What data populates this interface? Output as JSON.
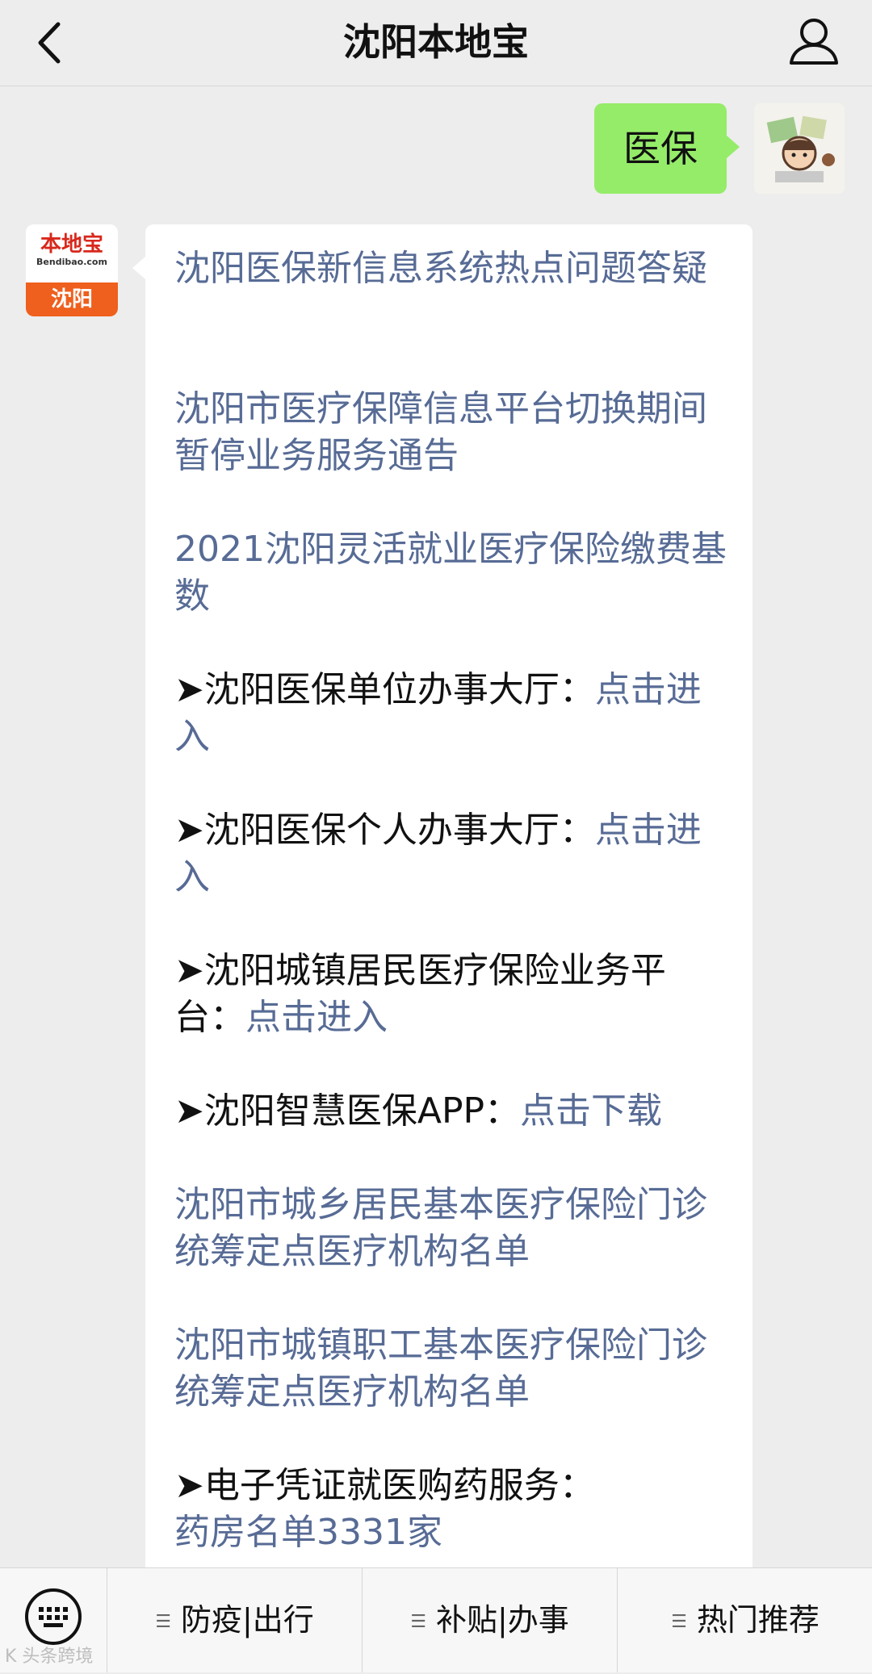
{
  "header": {
    "title": "沈阳本地宝",
    "back_icon": "chevron-left-icon",
    "user_icon": "person-icon"
  },
  "me": {
    "message": "医保"
  },
  "bot": {
    "avatar_top": "本地宝",
    "avatar_sub": "Bendibao.com",
    "avatar_city": "沈阳",
    "messages": [
      {
        "prefix": "",
        "text": "沈阳医保新信息系统热点问题答疑"
      },
      {
        "prefix": "",
        "text": "沈阳市医疗保障信息平台切换期间暂停业务服务通告"
      },
      {
        "prefix": "",
        "text": "2021沈阳灵活就业医疗保险缴费基数"
      },
      {
        "prefix": "➤沈阳医保单位办事大厅：",
        "text": "点击进入"
      },
      {
        "prefix": "➤沈阳医保个人办事大厅：",
        "text": "点击进入"
      },
      {
        "prefix": "➤沈阳城镇居民医疗保险业务平台：",
        "text": "点击进入"
      },
      {
        "prefix": "➤沈阳智慧医保APP：",
        "text": "点击下载"
      },
      {
        "prefix": "",
        "text": "沈阳市城乡居民基本医疗保险门诊统筹定点医疗机构名单"
      },
      {
        "prefix": "",
        "text": "沈阳市城镇职工基本医疗保险门诊统筹定点医疗机构名单"
      },
      {
        "prefix": "➤电子凭证就医购药服务：",
        "text": "药房名单3331家"
      }
    ]
  },
  "bottom_menu": {
    "keyboard_icon": "keyboard-icon",
    "items": [
      "防疫|出行",
      "补贴|办事",
      "热门推荐"
    ]
  },
  "watermark": "K 头条跨境",
  "colors": {
    "link": "#576b95",
    "my_bubble": "#95ec69",
    "background": "#ededed",
    "brand_orange": "#ef5f1d",
    "brand_red": "#d8281c"
  }
}
